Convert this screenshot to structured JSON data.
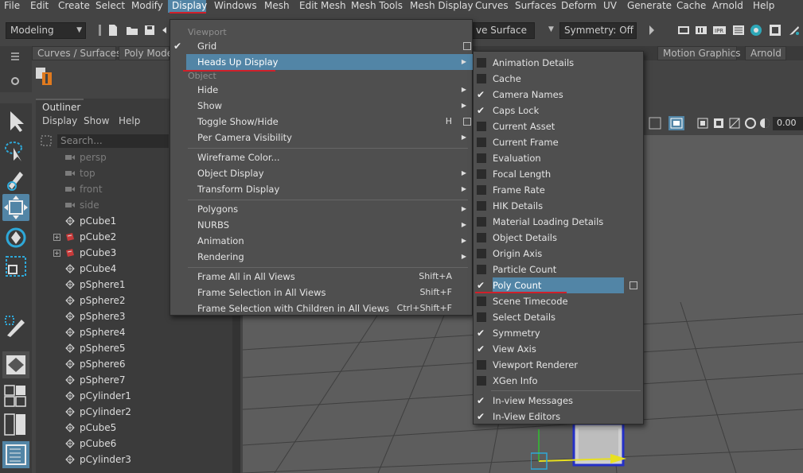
{
  "menubar": {
    "items": [
      "File",
      "Edit",
      "Create",
      "Select",
      "Modify",
      "Display",
      "Windows",
      "Mesh",
      "Edit Mesh",
      "Mesh Tools",
      "Mesh Display",
      "Curves",
      "Surfaces",
      "Deform",
      "UV",
      "Generate",
      "Cache",
      "Arnold",
      "Help"
    ],
    "active": "Display"
  },
  "statusline": {
    "mode": "Modeling",
    "live_surface_fragment": "ve Surface",
    "symmetry": "Symmetry: Off"
  },
  "shelf": {
    "tabs_left": [
      "Curves / Surfaces",
      "Poly Mode"
    ],
    "tabs_right": [
      "Motion Graphics",
      "Arnold"
    ]
  },
  "outliner": {
    "tab": "Outliner",
    "menu": [
      "Display",
      "Show",
      "Help"
    ],
    "search_placeholder": "Search...",
    "cameras": [
      "persp",
      "top",
      "front",
      "side"
    ],
    "objects": [
      "pCube1",
      "pCube2",
      "pCube3",
      "pCube4",
      "pSphere1",
      "pSphere2",
      "pSphere3",
      "pSphere4",
      "pSphere5",
      "pSphere6",
      "pSphere7",
      "pCylinder1",
      "pCylinder2",
      "pCube5",
      "pCube6",
      "pCylinder3"
    ]
  },
  "viewport": {
    "field_value": "0.00"
  },
  "display_menu": {
    "section_viewport": "Viewport",
    "grid": "Grid",
    "heads_up_display": "Heads Up Display",
    "section_object": "Object",
    "hide": "Hide",
    "show": "Show",
    "toggle_show_hide": "Toggle Show/Hide",
    "toggle_show_hide_shortcut": "H",
    "per_camera_visibility": "Per Camera Visibility",
    "wireframe_color": "Wireframe Color...",
    "object_display": "Object Display",
    "transform_display": "Transform Display",
    "polygons": "Polygons",
    "nurbs": "NURBS",
    "animation": "Animation",
    "rendering": "Rendering",
    "frame_all": "Frame All in All Views",
    "frame_all_shortcut": "Shift+A",
    "frame_selection": "Frame Selection in All Views",
    "frame_selection_shortcut": "Shift+F",
    "frame_selection_children": "Frame Selection with Children in All Views",
    "frame_selection_children_shortcut": "Ctrl+Shift+F"
  },
  "hud_menu": {
    "items": [
      {
        "label": "Animation Details",
        "checked": false
      },
      {
        "label": "Cache",
        "checked": false
      },
      {
        "label": "Camera Names",
        "checked": true
      },
      {
        "label": "Caps Lock",
        "checked": true
      },
      {
        "label": "Current Asset",
        "checked": false
      },
      {
        "label": "Current Frame",
        "checked": false
      },
      {
        "label": "Evaluation",
        "checked": false
      },
      {
        "label": "Focal Length",
        "checked": false
      },
      {
        "label": "Frame Rate",
        "checked": false
      },
      {
        "label": "HIK Details",
        "checked": false
      },
      {
        "label": "Material Loading Details",
        "checked": false
      },
      {
        "label": "Object Details",
        "checked": false
      },
      {
        "label": "Origin Axis",
        "checked": false
      },
      {
        "label": "Particle Count",
        "checked": false
      },
      {
        "label": "Poly Count",
        "checked": true
      },
      {
        "label": "Scene Timecode",
        "checked": false
      },
      {
        "label": "Select Details",
        "checked": false
      },
      {
        "label": "Symmetry",
        "checked": true
      },
      {
        "label": "View Axis",
        "checked": true
      },
      {
        "label": "Viewport Renderer",
        "checked": false
      },
      {
        "label": "XGen Info",
        "checked": false
      },
      {
        "label": "In-view Messages",
        "checked": true
      },
      {
        "label": "In-View Editors",
        "checked": true
      }
    ]
  },
  "colors": {
    "highlight": "#5285a6",
    "annotation_underline": "#d0202a"
  }
}
